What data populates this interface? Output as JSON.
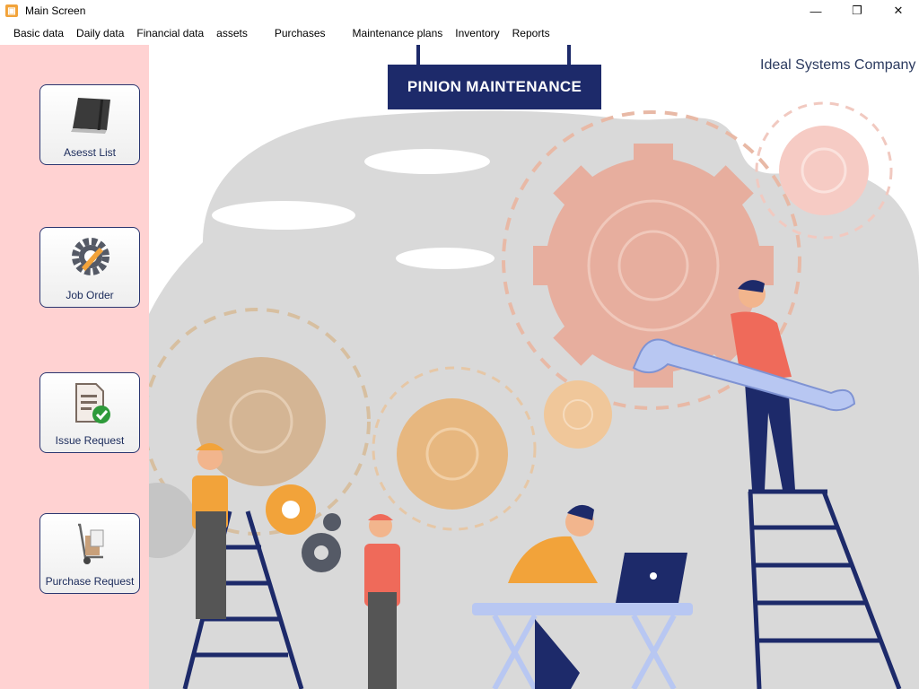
{
  "window": {
    "title": "Main Screen",
    "app_icon": "app-icon"
  },
  "menu": [
    {
      "label": "Basic data"
    },
    {
      "label": "Daily data"
    },
    {
      "label": "Financial data"
    },
    {
      "label": "assets"
    },
    {
      "label": "Purchases"
    },
    {
      "label": "Maintenance plans"
    },
    {
      "label": "Inventory"
    },
    {
      "label": "Reports"
    }
  ],
  "sidebar": {
    "buttons": [
      {
        "label": "Asesst List",
        "icon": "notebook-icon"
      },
      {
        "label": "Job Order",
        "icon": "gear-wrench-icon"
      },
      {
        "label": "Issue Request",
        "icon": "document-check-icon"
      },
      {
        "label": "Purchase Request",
        "icon": "hand-truck-icon"
      }
    ]
  },
  "banner": {
    "title": "PINION MAINTENANCE",
    "company": "Ideal Systems Company"
  },
  "colors": {
    "sidebar_bg": "#ffd2d2",
    "sign_bg": "#1d2a6a",
    "accent_orange": "#f2a33a",
    "border_navy": "#2b3670"
  }
}
